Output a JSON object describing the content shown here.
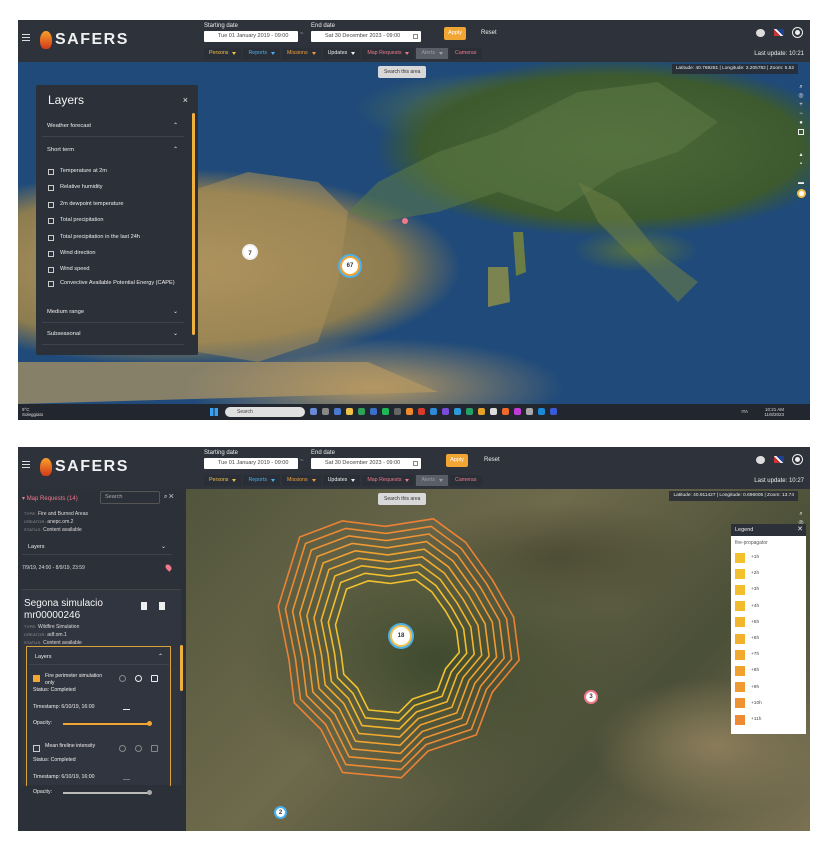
{
  "app": {
    "brand": "SAFERS"
  },
  "top": {
    "start_label": "Starting date",
    "end_label": "End date",
    "start_value": "Tue 01 January 2019 - 09:00",
    "end_value": "Sat 30 December 2023 - 09:00",
    "separator": "~",
    "apply": "Apply",
    "reset": "Reset",
    "filters": [
      {
        "label": "Persons",
        "color": "#f1c24a"
      },
      {
        "label": "Reports",
        "color": "#4ab0f0"
      },
      {
        "label": "Missions",
        "color": "#f0a03c"
      },
      {
        "label": "Updates",
        "color": "#eeeeee"
      },
      {
        "label": "Map Requests",
        "color": "#f07a8a"
      },
      {
        "label": "Alerts",
        "color": "#9a9ea5",
        "disabled": true
      },
      {
        "label": "Cameras",
        "color": "#f07a8a"
      }
    ]
  },
  "shot1": {
    "last_update": "Last update: 10:21",
    "coords": "Latitude: 40.769281 | Longitude: 3.205782 | Zoom: 5.52",
    "search_area": "Search this area",
    "clusters": [
      {
        "label": "7"
      },
      {
        "label": "67"
      }
    ],
    "layers_panel": {
      "title": "Layers",
      "close": "×",
      "sections": {
        "weather_forecast": "Weather forecast",
        "short_term": "Short term",
        "medium_range": "Medium range",
        "subseasonal": "Subseasonal"
      },
      "items": [
        "Temperature at 2m",
        "Relative humidity",
        "2m dewpoint temperature",
        "Total precipitation",
        "Total precipitation in the last 24h",
        "Wind direction",
        "Wind speed",
        "Convective Available Potential Energy (CAPE)"
      ]
    },
    "taskbar": {
      "weather_temp": "9°C",
      "weather_desc": "Soleggiato",
      "search": "Search",
      "lang": "ITA",
      "time": "10:21 AM",
      "date": "11/8/2023"
    }
  },
  "shot2": {
    "last_update": "Last update: 10:27",
    "coords": "Latitude: 40.911427 | Longitude: 0.696005 | Zoom: 13.74",
    "search_area": "Search this area",
    "clusters": [
      {
        "label": "18"
      },
      {
        "label": "3"
      },
      {
        "label": "2"
      }
    ],
    "side": {
      "header": "Map Requests (14)",
      "search_placeholder": "Search",
      "item1": {
        "type_label": "TYPE:",
        "type_value": "Fire and Burned Areas",
        "creator_label": "CREATOR:",
        "creator_value": "anepc.om.2",
        "status_label": "STATUS:",
        "status_value": "Content available",
        "layers": "Layers",
        "dates": "7/9/19, 24:00 - 8/9/19, 23:59"
      },
      "item2": {
        "title": "Segona simulacio",
        "code": "mr00000246",
        "type_label": "TYPE:",
        "type_value": "Wildfire Simulation",
        "creator_label": "CREATOR:",
        "creator_value": "adf.om.1",
        "status_label": "STATUS:",
        "status_value": "Content available",
        "layers": "Layers",
        "layer1": {
          "name": "Fire perimeter simulation only",
          "status": "Status: Completed",
          "timestamp": "Timestamp: 6/10/19, 16:00",
          "opacity": "Opacity:",
          "checked": true,
          "opacity_level": 1.0
        },
        "layer2": {
          "name": "Mean fireline intensity",
          "status": "Status: Completed",
          "timestamp": "Timestamp: 6/10/19, 16:00",
          "opacity": "Opacity:",
          "checked": false,
          "opacity_level": 1.0
        }
      }
    },
    "legend": {
      "title": "Legend",
      "subtitle": "fire-propagator",
      "items": [
        {
          "label": "+1h",
          "color": "#f2c12e"
        },
        {
          "label": "+2h",
          "color": "#f2c12e"
        },
        {
          "label": "+3h",
          "color": "#f2be2e"
        },
        {
          "label": "+4h",
          "color": "#f2bb2e"
        },
        {
          "label": "+5h",
          "color": "#f2b62e"
        },
        {
          "label": "+6h",
          "color": "#f2b02f"
        },
        {
          "label": "+7h",
          "color": "#f1a930"
        },
        {
          "label": "+8h",
          "color": "#f0a231"
        },
        {
          "label": "+9h",
          "color": "#ef9a32"
        },
        {
          "label": "+10h",
          "color": "#ee9233"
        },
        {
          "label": "+11h",
          "color": "#ed8a34"
        }
      ]
    }
  }
}
